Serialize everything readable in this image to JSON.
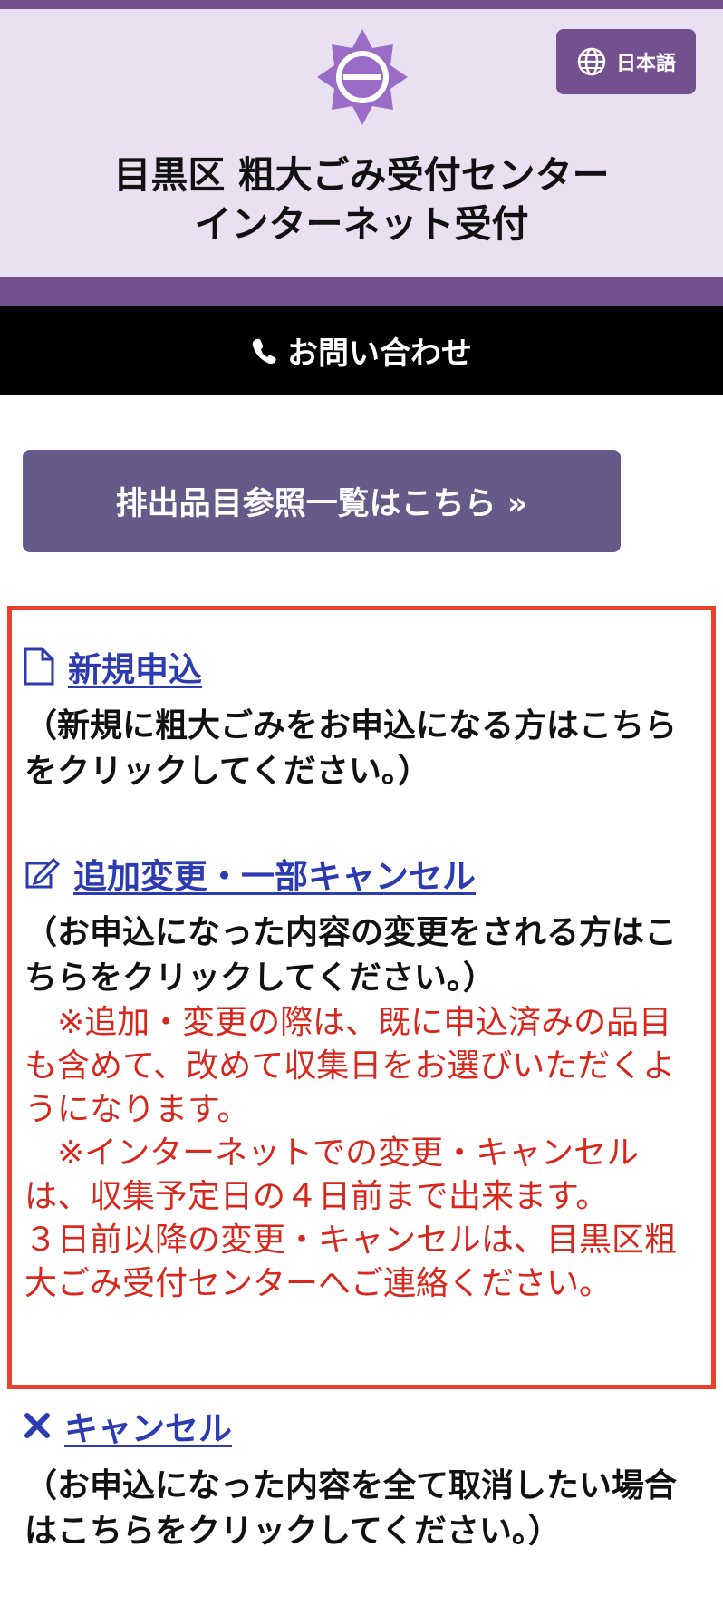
{
  "header": {
    "language_label": "日本語",
    "title_line1": "目黒区 粗大ごみ受付センター",
    "title_line2": "インターネット受付",
    "brand_color": "#74508f"
  },
  "contact": {
    "label": "お問い合わせ"
  },
  "list_button": {
    "label": "排出品目参照一覧はこちら »"
  },
  "options": {
    "new": {
      "icon": "document-icon",
      "label": "新規申込",
      "description": "（新規に粗大ごみをお申込になる方はこちらをクリックしてください。）"
    },
    "modify": {
      "icon": "edit-icon",
      "label": "追加変更・一部キャンセル",
      "description": "（お申込になった内容の変更をされる方はこちらをクリックしてください。）",
      "note1": "　※追加・変更の際は、既に申込済みの品目も含めて、改めて収集日をお選びいただくようになります。",
      "note2": "　※インターネットでの変更・キャンセルは、収集予定日の４日前まで出来ます。",
      "note3": "３日前以降の変更・キャンセルは、目黒区粗大ごみ受付センターへご連絡ください。"
    },
    "cancel": {
      "icon": "x-icon",
      "label": "キャンセル",
      "description": "（お申込になった内容を全て取消したい場合はこちらをクリックしてください。）"
    }
  }
}
